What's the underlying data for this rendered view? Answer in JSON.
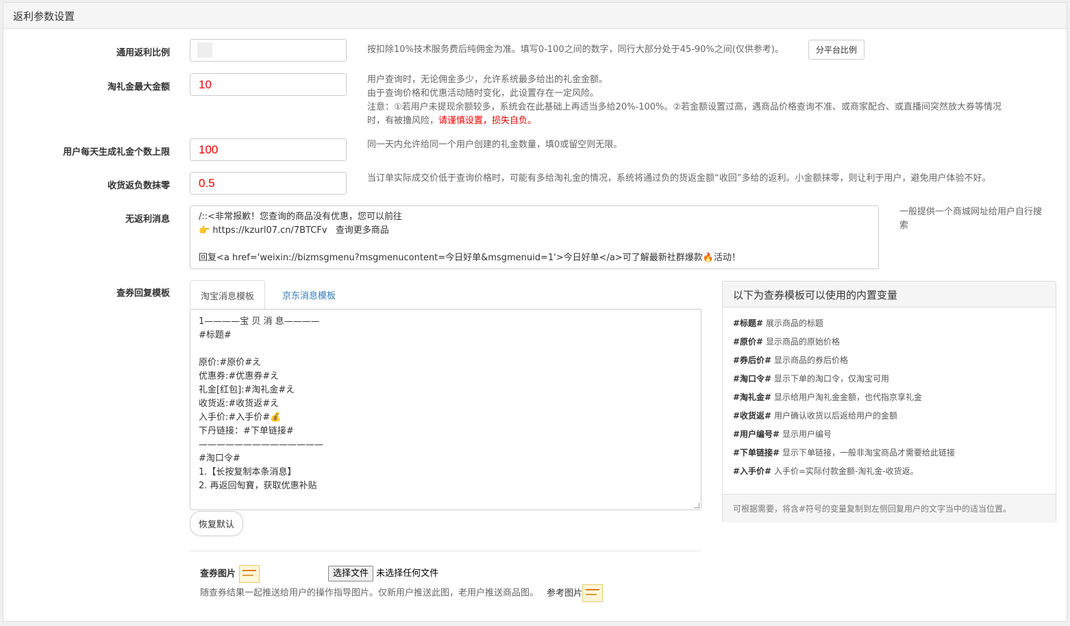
{
  "panel": {
    "title": "返利参数设置"
  },
  "fields": {
    "general_rate": {
      "label": "通用返利比例",
      "value": "",
      "help": "按扣除10%技术服务费后纯佣金为准。填写0-100之间的数字，同行大部分处于45-90%之间(仅供参考)。",
      "platform_button": "分平台比例"
    },
    "max_gift": {
      "label": "淘礼金最大金额",
      "value": "10",
      "help_line1": "用户查询时，无论佣金多少，允许系统最多给出的礼金金额。",
      "help_line2": "由于查询价格和优惠活动随时变化，此设置存在一定风险。",
      "help_line3": "注意：①若用户未提现余额较多，系统会在此基础上再适当多给20%-100%。②若金额设置过高，遇商品价格查询不准、或商家配合、或直播间突然放大券等情况",
      "help_line4_a": "时，有被撸风险，",
      "help_line4_red": "请谨慎设置，损失自负。"
    },
    "daily_limit": {
      "label": "用户每天生成礼金个数上限",
      "value": "100",
      "help": "同一天内允许给同一个用户创建的礼金数量，填0或留空则无限。"
    },
    "rounding": {
      "label": "收货返负数抹零",
      "value": "0.5",
      "help": "当订单实际成交价低于查询价格时，可能有多给淘礼金的情况，系统将通过负的货返金额“收回”多给的返利。小金额抹零，则让利于用户，避免用户体验不好。"
    },
    "no_rebate": {
      "label": "无返利消息",
      "line1": "/::<非常报歉！您查询的商品没有优惠，您可以前往",
      "line2_icon": "👉",
      "line2": " https://kzurl07.cn/7BTCFv   查询更多商品",
      "line3": "",
      "line4": "回复<a href='weixin://bizmsgmenu?msgmenucontent=今日好单&msgmenuid=1'>今日好单</a>可了解最新社群爆款🔥活动！",
      "help_line1": "一般提供一个商城网址给用户自行搜",
      "help_line2": "索"
    },
    "template": {
      "label": "查券回复模板",
      "tabs": [
        "淘宝消息模板",
        "京东消息模板"
      ],
      "content": "1————宝 贝 消 息————\n#标题#\n\n原价:#原价#え\n优惠券:#优惠券#え\n礼金[红包]:#淘礼金#え\n收货返:#收货返#え\n入手价:#入手价#💰\n下丹链接：#下单链接#\n——————————————\n#淘口令#\n1.【长按复制本条消息】\n2. 再返回匋寶，获取优惠补贴",
      "restore_button": "恢复默认"
    },
    "coupon_image": {
      "label": "查券图片",
      "file_button": "选择文件",
      "file_status": "未选择任何文件",
      "help": "随查券结果一起推送给用户的操作指导图片。仅新用户推送此图，老用户推送商品图。",
      "ref_label": "参考图片"
    }
  },
  "variables": {
    "title": "以下为查券模板可以使用的内置变量",
    "items": [
      {
        "key": "#标题#",
        "desc": " 展示商品的标题"
      },
      {
        "key": "#原价#",
        "desc": " 显示商品的原始价格"
      },
      {
        "key": "#券后价#",
        "desc": " 显示商品的券后价格"
      },
      {
        "key": "#淘口令#",
        "desc": " 显示下单的淘口令，仅淘宝可用"
      },
      {
        "key": "#淘礼金#",
        "desc": " 显示给用户淘礼金金额，也代指京享礼金"
      },
      {
        "key": "#收货返#",
        "desc": " 用户确认收货以后返给用户的金额"
      },
      {
        "key": "#用户编号#",
        "desc": " 显示用户编号"
      },
      {
        "key": "#下单链接#",
        "desc": " 显示下单链接，一般非淘宝商品才需要给此链接"
      },
      {
        "key": "#入手价#",
        "desc": " 入手价=实际付款金额-淘礼金-收货返。"
      }
    ],
    "footer": "可根据需要，将含#符号的变量复制到左侧回复用户的文字当中的适当位置。"
  },
  "colors": {
    "accent_red": "#e00000",
    "link": "#337ab7"
  }
}
